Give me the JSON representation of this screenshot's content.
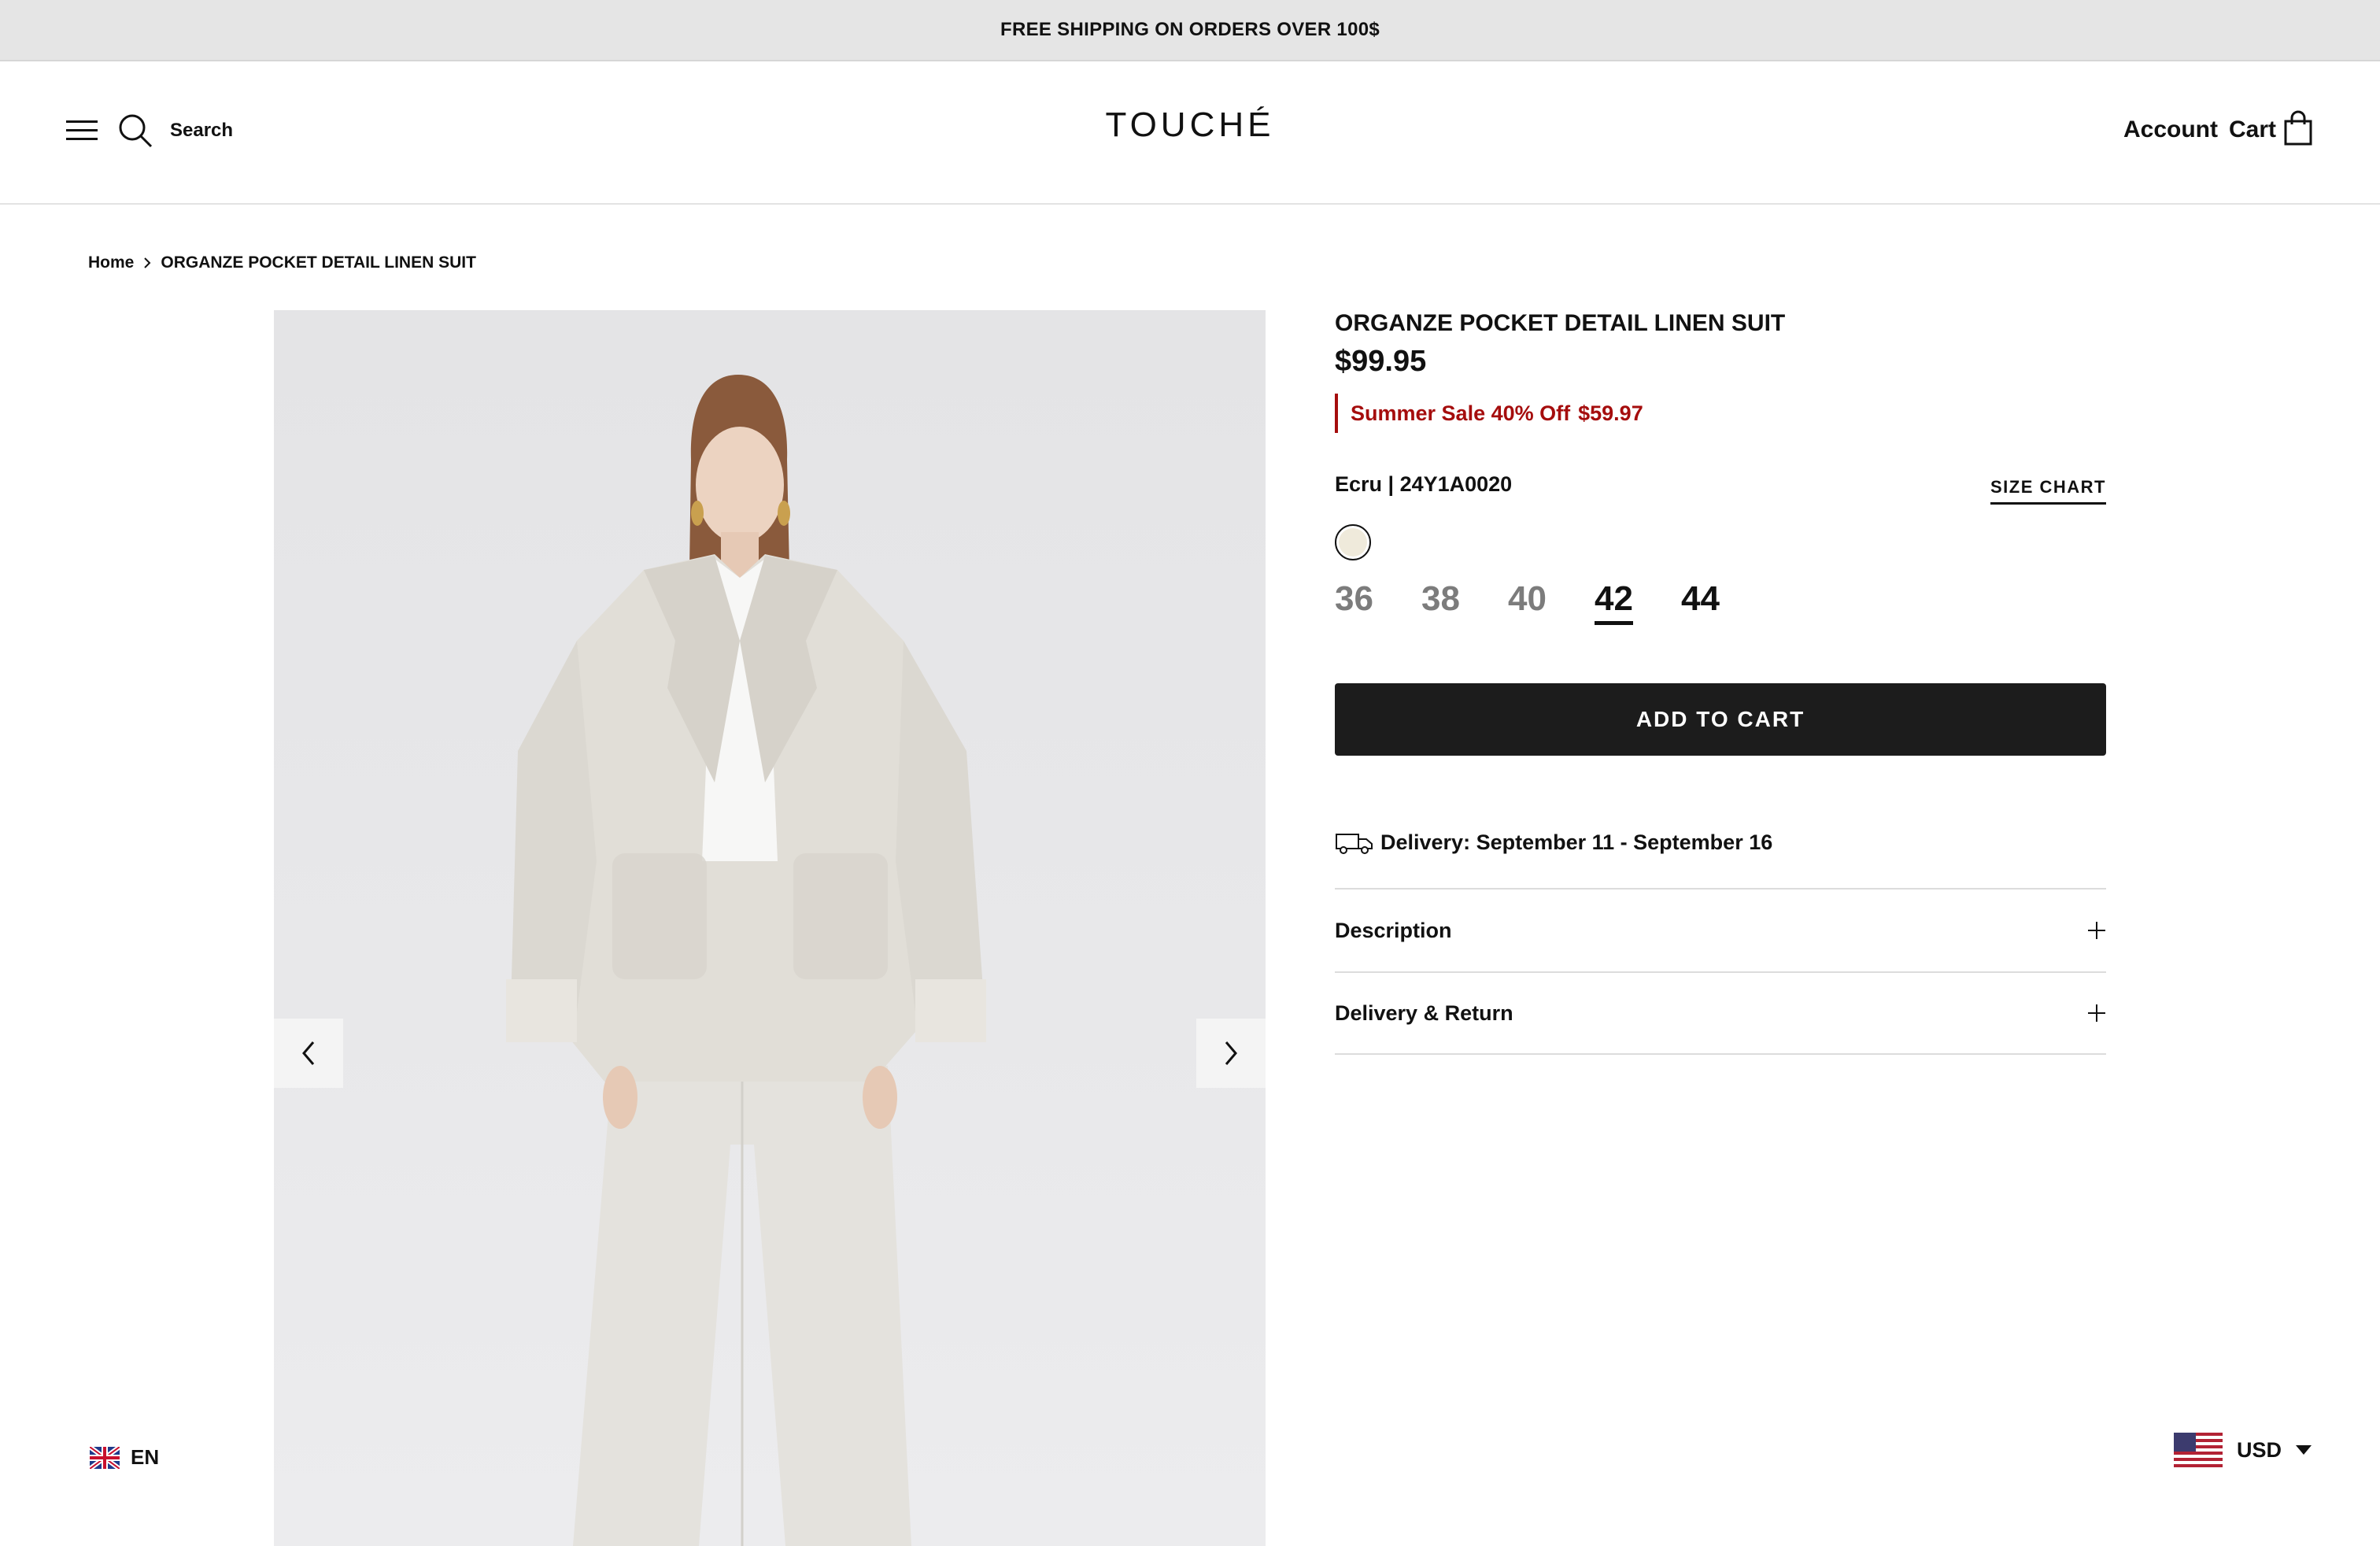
{
  "announcement": "FREE SHIPPING ON ORDERS OVER 100$",
  "header": {
    "search_label": "Search",
    "logo": "TOUCHÉ",
    "account_label": "Account",
    "cart_label": "Cart"
  },
  "breadcrumb": {
    "home": "Home",
    "current": "ORGANZE POCKET DETAIL LINEN SUIT"
  },
  "product": {
    "title": "ORGANZE POCKET DETAIL LINEN SUIT",
    "price": "$99.95",
    "sale_label": "Summer Sale 40% Off",
    "sale_price": "$59.97",
    "color_sku": "Ecru | 24Y1A0020",
    "size_chart_label": "SIZE CHART",
    "swatch_color": "#efeadb",
    "sizes": [
      "36",
      "38",
      "40",
      "42",
      "44"
    ],
    "selected_size": "42",
    "add_to_cart_label": "ADD TO CART",
    "delivery_text": "Delivery: September 11 - September 16",
    "accordion": [
      "Description",
      "Delivery & Return"
    ]
  },
  "locale": {
    "language": "EN",
    "currency": "USD"
  },
  "colors": {
    "sale_red": "#a50d0d",
    "button_bg": "#1c1c1c",
    "announcement_bg": "#e5e5e5"
  }
}
